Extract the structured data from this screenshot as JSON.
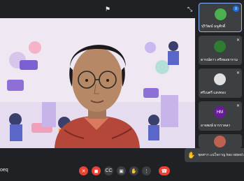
{
  "meeting": {
    "code": "oeq"
  },
  "participants": [
    {
      "name": "ปุริวัฒน์ มนูศักดิ์",
      "avatar_initial": "",
      "avatar_color": "#4caf50",
      "mic": "on"
    },
    {
      "name": "ดารณ์ดาว ศรีทองธาราม",
      "avatar_initial": "",
      "avatar_color": "#2e7d32",
      "mic": "off"
    },
    {
      "name": "ศรีเนตรี แสงทอง",
      "avatar_initial": "",
      "avatar_color": "#e0e0e0",
      "mic": "off"
    },
    {
      "name": "อาจพงษ์ ธารราคลา",
      "avatar_initial": "HM",
      "avatar_color": "#6a1b9a",
      "mic": "off"
    },
    {
      "name": "",
      "avatar_initial": "",
      "avatar_color": "#c06050",
      "mic": ""
    }
  ],
  "notification": {
    "text": "พุดศาก แน่ใจกาญ has raised a hand"
  },
  "icons": {
    "pin": "pin-icon",
    "collapse": "collapse-icon",
    "mic": "mic-off-icon",
    "camera": "camera-off-icon",
    "captions": "captions-icon",
    "present": "present-icon",
    "hand": "raise-hand-icon",
    "more": "more-icon",
    "end": "end-call-icon"
  }
}
